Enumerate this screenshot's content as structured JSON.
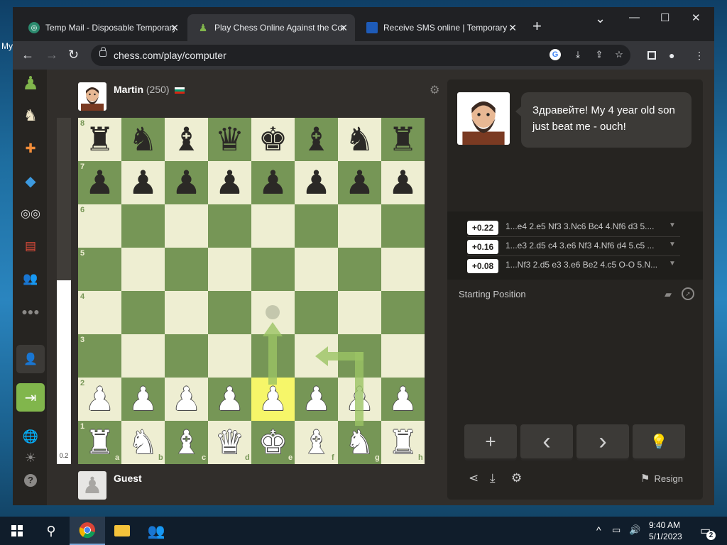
{
  "desktop": {
    "label_fragment": "My"
  },
  "browser": {
    "tabs": [
      {
        "title": "Temp Mail - Disposable Temporary",
        "close": "✕",
        "active": false
      },
      {
        "title": "Play Chess Online Against the Computer",
        "close": "✕",
        "active": true
      },
      {
        "title": "Receive SMS online | Temporary",
        "close": "✕",
        "active": false
      }
    ],
    "new_tab": "+",
    "window_controls": {
      "dropdown": "⌄",
      "minimize": "—",
      "maximize": "☐",
      "close": "✕"
    },
    "url": "chess.com/play/computer"
  },
  "game": {
    "opponent": {
      "name": "Martin",
      "rating": "(250)"
    },
    "player": {
      "name": "Guest"
    },
    "eval_bar_value": "0.2",
    "eval_white_fraction": 0.53,
    "board": {
      "ranks": [
        "8",
        "7",
        "6",
        "5",
        "4",
        "3",
        "2",
        "1"
      ],
      "files": [
        "a",
        "b",
        "c",
        "d",
        "e",
        "f",
        "g",
        "h"
      ],
      "position": [
        [
          "♜",
          "♞",
          "♝",
          "♛",
          "♚",
          "♝",
          "♞",
          "♜"
        ],
        [
          "♟",
          "♟",
          "♟",
          "♟",
          "♟",
          "♟",
          "♟",
          "♟"
        ],
        [
          "",
          "",
          "",
          "",
          "",
          "",
          "",
          ""
        ],
        [
          "",
          "",
          "",
          "",
          "",
          "",
          "",
          ""
        ],
        [
          "",
          "",
          "",
          "",
          "",
          "",
          "",
          ""
        ],
        [
          "",
          "",
          "",
          "",
          "",
          "",
          "",
          ""
        ],
        [
          "♟",
          "♟",
          "♟",
          "♟",
          "♟",
          "♟",
          "♟",
          "♟"
        ],
        [
          "♜",
          "♞",
          "♝",
          "♛",
          "♚",
          "♝",
          "♞",
          "♜"
        ]
      ],
      "highlight_square": "e2"
    },
    "coach_message": "Здравейте! My 4 year old son just beat me - ouch!",
    "engine_lines": [
      {
        "score": "+0.22",
        "moves": "1...e4 2.e5 Nf3 3.Nc6 Bc4 4.Nf6 d3 5...."
      },
      {
        "score": "+0.16",
        "moves": "1...e3 2.d5 c4 3.e6 Nf3 4.Nf6 d4 5.c5 ..."
      },
      {
        "score": "+0.08",
        "moves": "1...Nf3 2.d5 e3 3.e6 Be2 4.c5 O-O 5.N..."
      }
    ],
    "starting_position_label": "Starting Position",
    "controls": [
      "+",
      "‹",
      "›",
      "💡"
    ],
    "resign_label": "Resign"
  },
  "taskbar": {
    "time": "9:40 AM",
    "date": "5/1/2023",
    "notification_count": "2"
  }
}
